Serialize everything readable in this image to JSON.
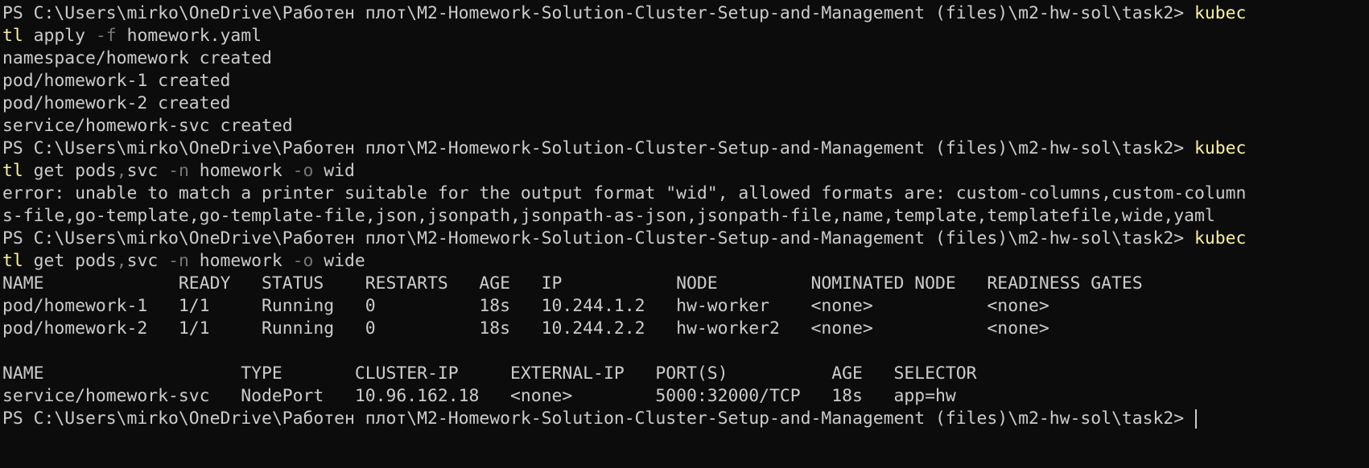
{
  "colors": {
    "background": "#0c0c0c",
    "foreground": "#cccccc",
    "command": "#f9f1a5",
    "parameter": "#767676"
  },
  "lines": [
    {
      "type": "prompt",
      "prompt": "PS C:\\Users\\mirko\\OneDrive\\Работен плот\\M2-Homework-Solution-Cluster-Setup-and-Management (files)\\m2-hw-sol\\task2> ",
      "command_head": "kubec"
    },
    {
      "type": "command-cont",
      "command_tail": "tl",
      "args_a": " apply ",
      "flag_a": "-f",
      "args_b": " homework.yaml"
    },
    {
      "type": "output",
      "text": "namespace/homework created"
    },
    {
      "type": "output",
      "text": "pod/homework-1 created"
    },
    {
      "type": "output",
      "text": "pod/homework-2 created"
    },
    {
      "type": "output",
      "text": "service/homework-svc created"
    },
    {
      "type": "prompt",
      "prompt": "PS C:\\Users\\mirko\\OneDrive\\Работен плот\\M2-Homework-Solution-Cluster-Setup-and-Management (files)\\m2-hw-sol\\task2> ",
      "command_head": "kubec"
    },
    {
      "type": "command-cont",
      "command_tail": "tl",
      "args_a": " get pods",
      "comma": ",",
      "args_b": "svc ",
      "flag_a": "-n",
      "args_c": " homework ",
      "flag_b": "-o",
      "args_d": " wid"
    },
    {
      "type": "output",
      "text": "error: unable to match a printer suitable for the output format \"wid\", allowed formats are: custom-columns,custom-column"
    },
    {
      "type": "output",
      "text": "s-file,go-template,go-template-file,json,jsonpath,jsonpath-as-json,jsonpath-file,name,template,templatefile,wide,yaml"
    },
    {
      "type": "prompt",
      "prompt": "PS C:\\Users\\mirko\\OneDrive\\Работен плот\\M2-Homework-Solution-Cluster-Setup-and-Management (files)\\m2-hw-sol\\task2> ",
      "command_head": "kubec"
    },
    {
      "type": "command-cont",
      "command_tail": "tl",
      "args_a": " get pods",
      "comma": ",",
      "args_b": "svc ",
      "flag_a": "-n",
      "args_c": " homework ",
      "flag_b": "-o",
      "args_d": " wide"
    },
    {
      "type": "output",
      "text": "NAME             READY   STATUS    RESTARTS   AGE   IP           NODE         NOMINATED NODE   READINESS GATES"
    },
    {
      "type": "output",
      "text": "pod/homework-1   1/1     Running   0          18s   10.244.1.2   hw-worker    <none>           <none>"
    },
    {
      "type": "output",
      "text": "pod/homework-2   1/1     Running   0          18s   10.244.2.2   hw-worker2   <none>           <none>"
    },
    {
      "type": "output",
      "text": ""
    },
    {
      "type": "output",
      "text": "NAME                   TYPE       CLUSTER-IP     EXTERNAL-IP   PORT(S)          AGE   SELECTOR"
    },
    {
      "type": "output",
      "text": "service/homework-svc   NodePort   10.96.162.18   <none>        5000:32000/TCP   18s   app=hw"
    },
    {
      "type": "prompt-final",
      "prompt": "PS C:\\Users\\mirko\\OneDrive\\Работен плот\\M2-Homework-Solution-Cluster-Setup-and-Management (files)\\m2-hw-sol\\task2> "
    }
  ]
}
